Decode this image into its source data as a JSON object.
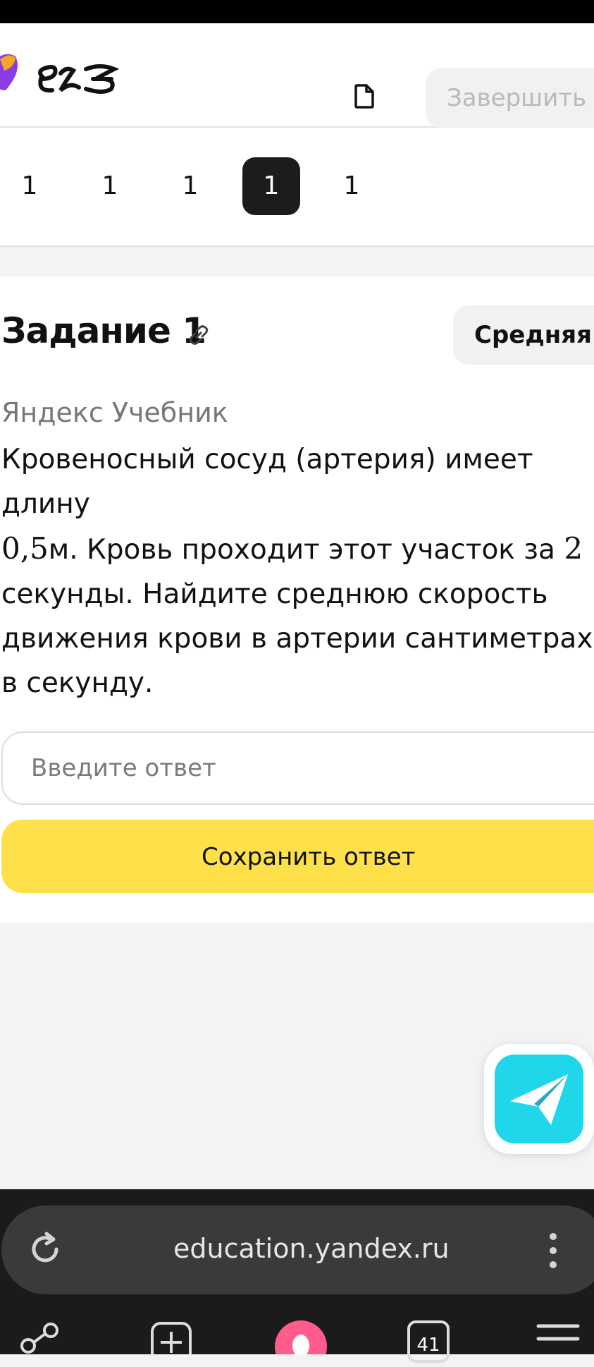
{
  "header": {
    "finish_label": "Завершить"
  },
  "task_nav": {
    "items": [
      "1",
      "1",
      "1",
      "1",
      "1"
    ],
    "active_index": 3
  },
  "task": {
    "title": "Задание 1",
    "difficulty": "Средняя",
    "source": "Яндекс Учебник",
    "text_part1": "Кровеносный сосуд (артерия) имеет длину",
    "length_value": "0,5",
    "text_part2": "м. Кровь проходит этот участок за",
    "time_value": "2",
    "text_part3": "секунды. Найдите среднюю скорость движения крови в артерии сантиметрах в секунду."
  },
  "answer": {
    "placeholder": "Введите ответ",
    "value": "",
    "save_label": "Сохранить ответ"
  },
  "browser": {
    "url": "education.yandex.ru",
    "tabs_count": "41"
  },
  "colors": {
    "accent_yellow": "#fde04a",
    "active_tab": "#1c1c1c",
    "telegram": "#1fd6ea"
  }
}
